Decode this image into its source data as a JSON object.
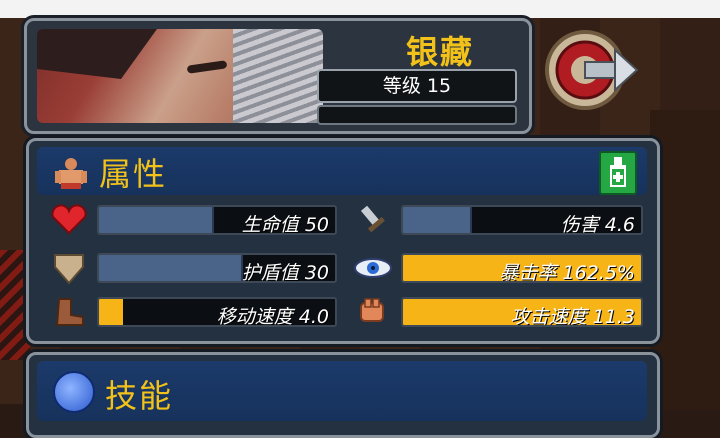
{
  "hero": {
    "name": "银藏",
    "level_text": "等级 15"
  },
  "attributes": {
    "title": "属性",
    "stats": [
      {
        "key": "health",
        "label": "生命值 50",
        "icon": "heart-icon",
        "fill": 0.48,
        "style": "blue"
      },
      {
        "key": "damage",
        "label": "伤害 4.6",
        "icon": "sword-icon",
        "fill": 0.28,
        "style": "blue"
      },
      {
        "key": "shield",
        "label": "护盾值 30",
        "icon": "shield-icon",
        "fill": 0.6,
        "style": "blue"
      },
      {
        "key": "crit",
        "label": "暴击率 162.5%",
        "icon": "eye-icon",
        "fill": 1.0,
        "style": "gold"
      },
      {
        "key": "speed",
        "label": "移动速度 4.0",
        "icon": "boot-icon",
        "fill": 0.1,
        "style": "gold"
      },
      {
        "key": "attack_speed",
        "label": "攻击速度 11.3",
        "icon": "fist-icon",
        "fill": 1.0,
        "style": "gold"
      }
    ]
  },
  "skills": {
    "title": "技能"
  },
  "colors": {
    "gold": "#f2c21a",
    "bar_blue": "#4a6389",
    "bar_gold": "#f6b416",
    "panel": "#243140"
  }
}
